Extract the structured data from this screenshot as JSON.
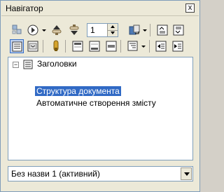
{
  "window": {
    "title": "Навігатор",
    "close_label": "x"
  },
  "toolbar": {
    "page_number": "1",
    "row1_icons": [
      "navigation-toggle-icon",
      "navigate-by-icon",
      "previous-icon",
      "next-icon",
      "drag-mode-icon",
      "promote-chapter-icon",
      "demote-chapter-icon"
    ],
    "row2_icons": [
      "list-box-icon",
      "content-view-icon",
      "reminder-icon",
      "header-icon",
      "footer-icon",
      "anchor-to-entry-icon",
      "heading-levels-icon",
      "promote-level-icon",
      "demote-level-icon"
    ]
  },
  "tree": {
    "root": {
      "label": "Заголовки",
      "expander": "−"
    },
    "children": [
      {
        "label": "Структура документа",
        "selected": true
      },
      {
        "label": "Автоматичне створення змісту",
        "selected": false
      }
    ]
  },
  "document_select": {
    "value": "Без назви 1 (активний)"
  },
  "colors": {
    "selection": "#316ac5",
    "border": "#7f9db9",
    "window_bg": "#ece9d8"
  }
}
